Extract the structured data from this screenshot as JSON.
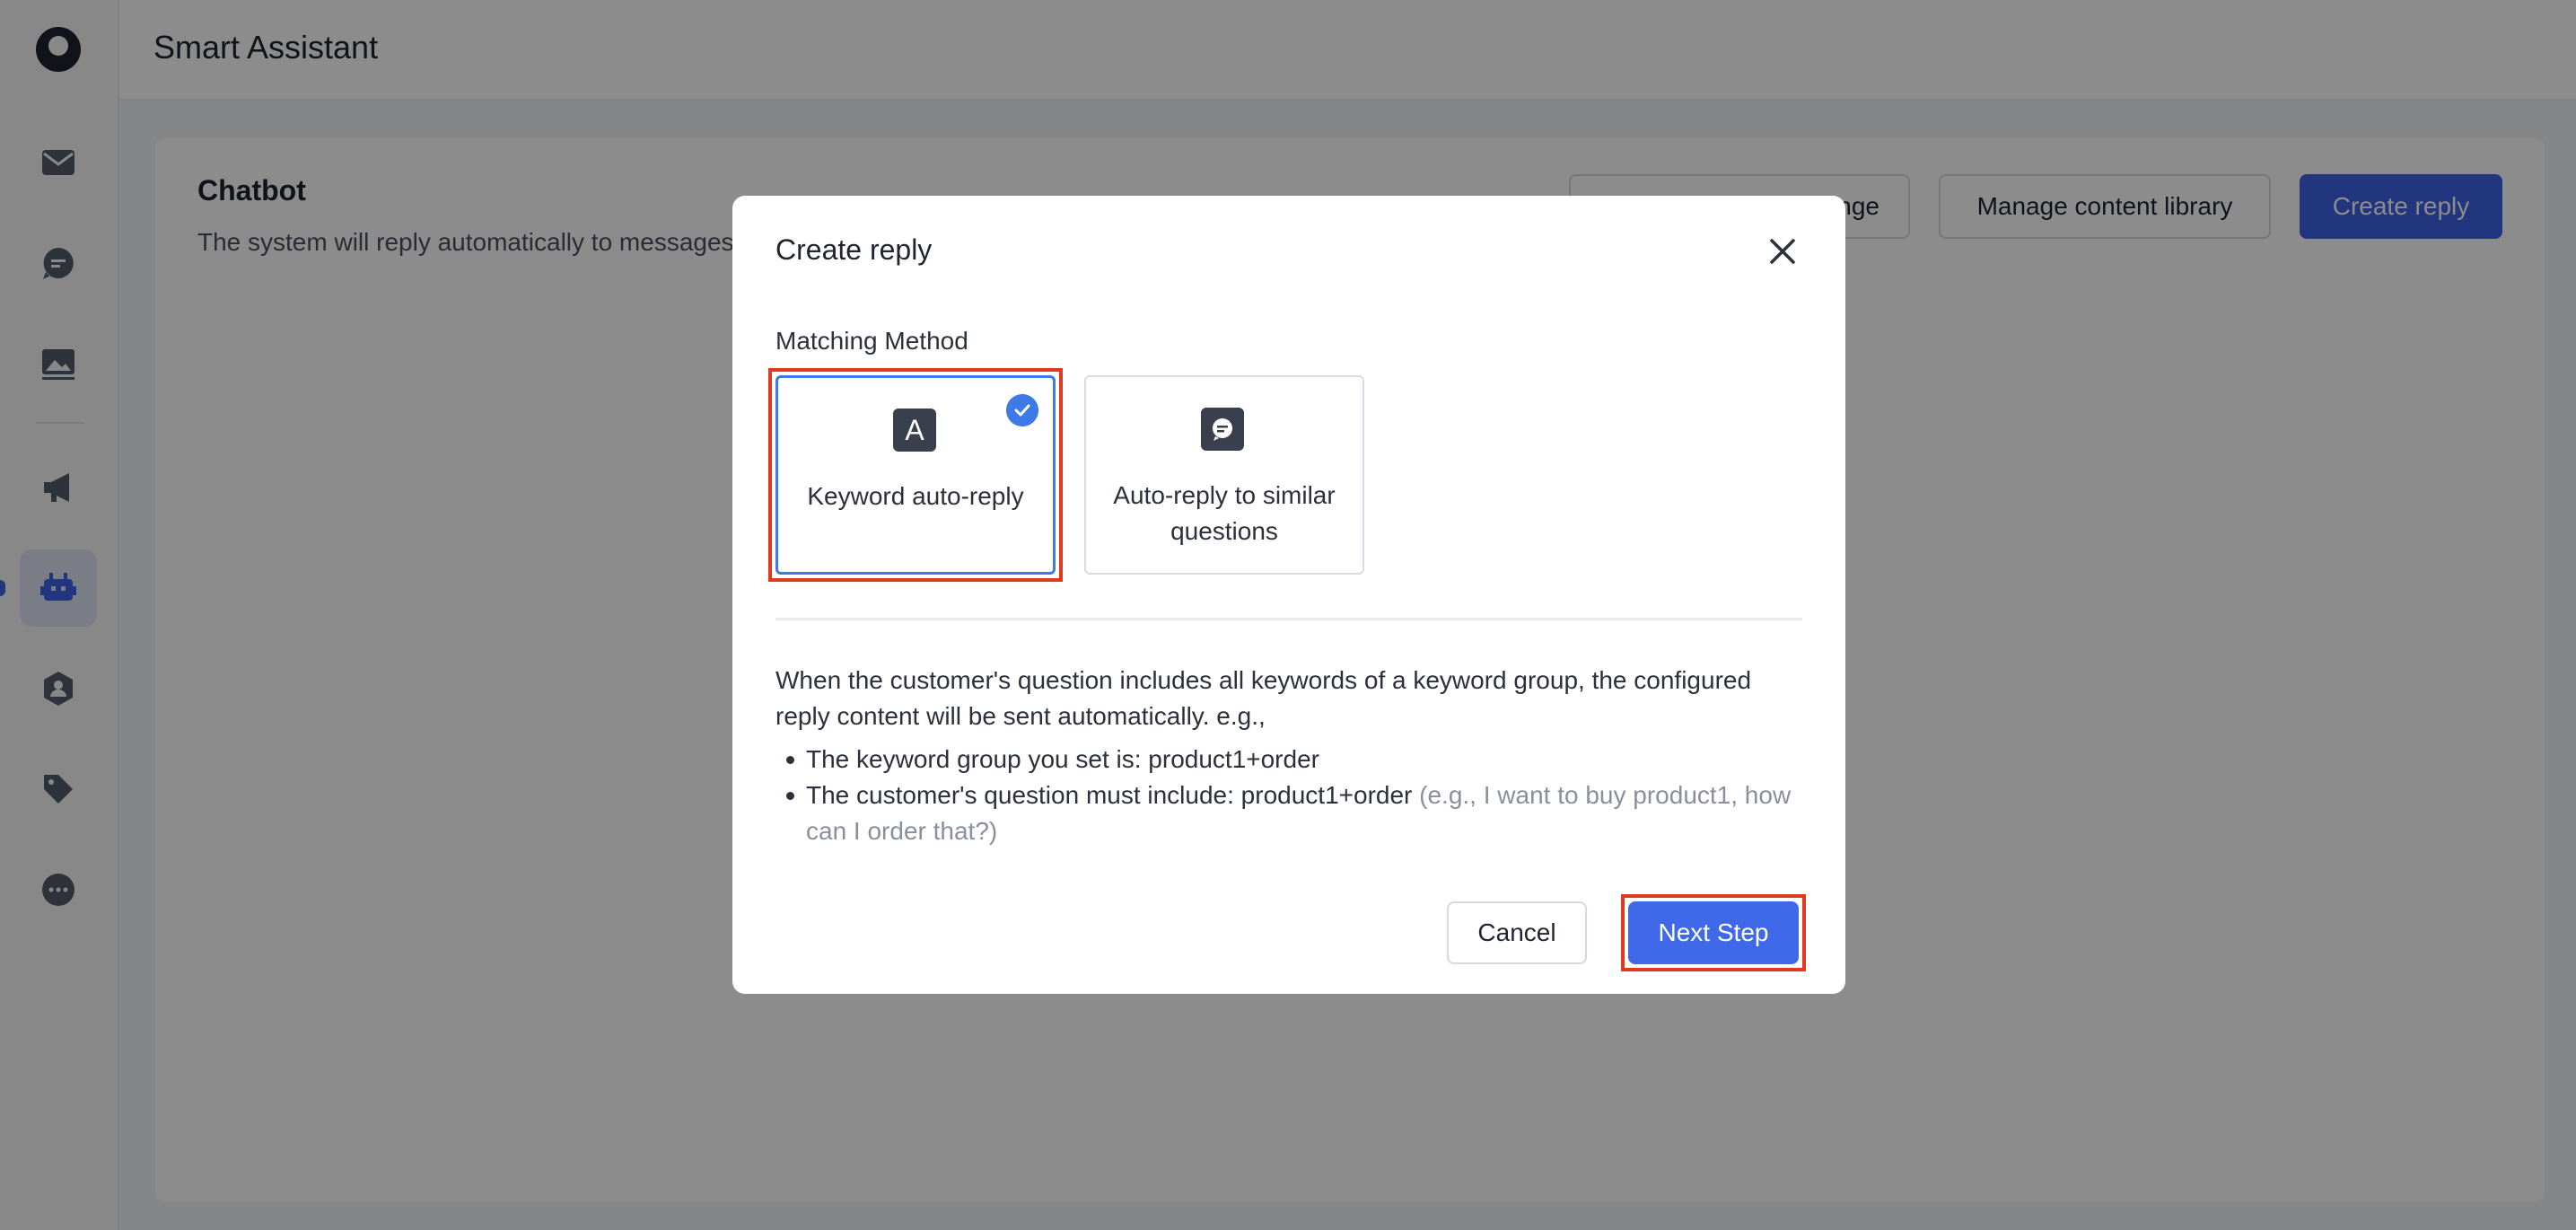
{
  "app": {
    "title": "Smart Assistant"
  },
  "sidebar": {
    "items": [
      {
        "name": "inbox",
        "icon": "mail-icon"
      },
      {
        "name": "chats",
        "icon": "chat-bubble-icon"
      },
      {
        "name": "media",
        "icon": "image-icon"
      },
      {
        "name": "broadcast",
        "icon": "megaphone-icon"
      },
      {
        "name": "chatbot",
        "icon": "robot-icon",
        "active": true
      },
      {
        "name": "contacts",
        "icon": "person-icon"
      },
      {
        "name": "tags",
        "icon": "tag-icon"
      },
      {
        "name": "more",
        "icon": "more-icon"
      }
    ]
  },
  "card": {
    "title": "Chatbot",
    "description": "The system will reply automatically to messages",
    "buttons": {
      "partial": "nge",
      "manage_library": "Manage content library",
      "create_reply": "Create reply"
    }
  },
  "modal": {
    "title": "Create reply",
    "section_label": "Matching Method",
    "options": [
      {
        "icon_text": "A",
        "label": "Keyword auto-reply",
        "selected": true
      },
      {
        "icon_text": "",
        "label": "Auto-reply to similar questions",
        "selected": false
      }
    ],
    "description": "When the customer's question includes all keywords of a keyword group, the configured reply content will be sent automatically. e.g.,",
    "bullets": [
      {
        "text": "The keyword group you set is: product1+order",
        "hint": ""
      },
      {
        "text": "The customer's question must include: product1+order ",
        "hint": "(e.g., I want to buy product1, how can I order that?)"
      }
    ],
    "cancel_label": "Cancel",
    "next_label": "Next Step"
  },
  "colors": {
    "primary": "#3d63e6",
    "selected_border": "#3d7ae6",
    "highlight": "#e0391f"
  }
}
